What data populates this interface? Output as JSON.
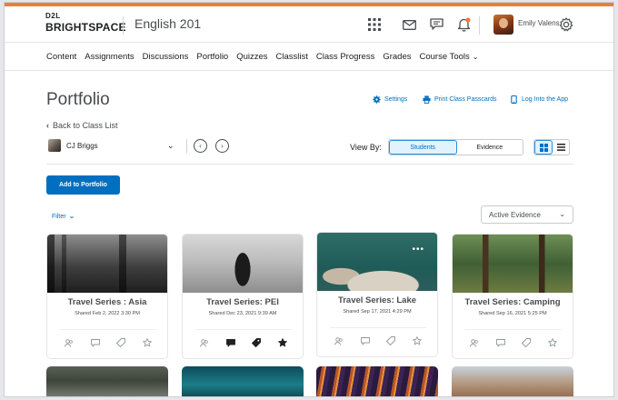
{
  "colors": {
    "accent": "#006fbf",
    "top_stripe": "#ec7e3a",
    "active_toggle_bg": "#e0f3ff"
  },
  "header": {
    "logo_top": "D2L",
    "logo_main": "BRIGHTSPACE",
    "course_title": "English 201",
    "icons": [
      "waffle-grid-icon",
      "mail-icon",
      "chat-icon",
      "bell-icon",
      "gear-icon"
    ],
    "notification_dot_color": "#ec7e3a",
    "user_name": "Emily Valens"
  },
  "nav": {
    "items": [
      {
        "label": "Content"
      },
      {
        "label": "Assignments"
      },
      {
        "label": "Discussions"
      },
      {
        "label": "Portfolio"
      },
      {
        "label": "Quizzes"
      },
      {
        "label": "Classlist"
      },
      {
        "label": "Class Progress"
      },
      {
        "label": "Grades"
      },
      {
        "label": "Course Tools"
      }
    ]
  },
  "page": {
    "title": "Portfolio",
    "tools": {
      "settings": "Settings",
      "print": "Print Class Passcards",
      "login_app": "Log Into the App"
    },
    "back_link": "Back to Class List",
    "student_name": "CJ Briggs",
    "view_by_label": "View By:",
    "view_by_options": [
      "Students",
      "Evidence"
    ],
    "view_by_selected": "Students",
    "layout_selected": "grid",
    "add_button": "Add to Portfolio",
    "filter_label": "Filter",
    "evidence_select_value": "Active Evidence"
  },
  "cards": [
    {
      "title": "Travel Series : Asia",
      "date": "Shared Feb 2, 2022 3:30 PM",
      "has_feedback": false,
      "has_tags": false,
      "starred": false
    },
    {
      "title": "Travel Series: PEI",
      "date": "Shared Dec 23, 2021 9:39 AM",
      "has_feedback": true,
      "has_tags": true,
      "starred": true
    },
    {
      "title": "Travel Series: Lake",
      "date": "Shared Sep 17, 2021 4:29 PM",
      "has_feedback": false,
      "has_tags": false,
      "starred": false
    },
    {
      "title": "Travel Series: Camping",
      "date": "Shared Sep 16, 2021 5:25 PM",
      "has_feedback": false,
      "has_tags": false,
      "starred": false
    }
  ]
}
